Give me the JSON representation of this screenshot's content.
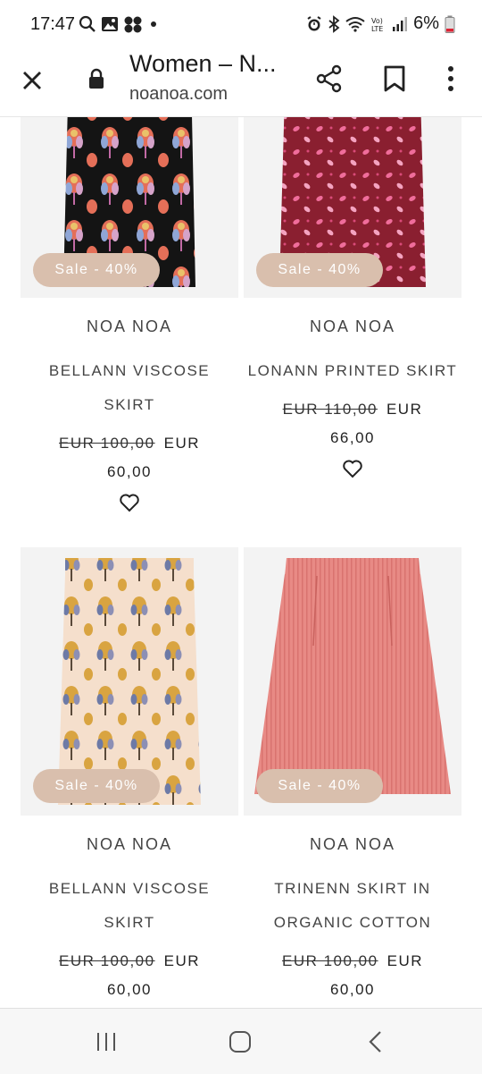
{
  "status_bar": {
    "time": "17:47",
    "battery": "6%",
    "left_icons": [
      "search-icon",
      "gallery-icon",
      "apps-icon",
      "dot-icon"
    ],
    "right_icons": [
      "alarm-icon",
      "bluetooth-icon",
      "wifi-icon",
      "volte-icon",
      "signal-icon",
      "battery-icon"
    ]
  },
  "toolbar": {
    "title": "Women – N...",
    "domain": "noanoa.com"
  },
  "products": [
    {
      "badge": "Sale - 40%",
      "brand": "NOA NOA",
      "name_line1": "BELLANN VISCOSE",
      "name_line2": "SKIRT",
      "old_price": "EUR 100,00",
      "currency": "EUR",
      "new_price": "60,00"
    },
    {
      "badge": "Sale - 40%",
      "brand": "NOA NOA",
      "name_line1": "LONANN PRINTED SKIRT",
      "name_line2": "",
      "old_price": "EUR 110,00",
      "currency": "EUR",
      "new_price": "66,00"
    },
    {
      "badge": "Sale - 40%",
      "brand": "NOA NOA",
      "name_line1": "BELLANN VISCOSE",
      "name_line2": "SKIRT",
      "old_price": "EUR 100,00",
      "currency": "EUR",
      "new_price": "60,00"
    },
    {
      "badge": "Sale - 40%",
      "brand": "NOA NOA",
      "name_line1": "TRINENN SKIRT IN",
      "name_line2": "ORGANIC COTTON",
      "old_price": "EUR 100,00",
      "currency": "EUR",
      "new_price": "60,00"
    }
  ],
  "colors": {
    "badge": "#d9bfad",
    "card_bg": "#f3f3f3",
    "skirt_black": "#141414",
    "skirt_burgundy": "#8a1f30",
    "skirt_cream": "#f5dfcc",
    "skirt_pink": "#e88a85"
  },
  "navbar": {
    "icons": [
      "recent-apps-icon",
      "home-icon",
      "back-icon"
    ]
  }
}
